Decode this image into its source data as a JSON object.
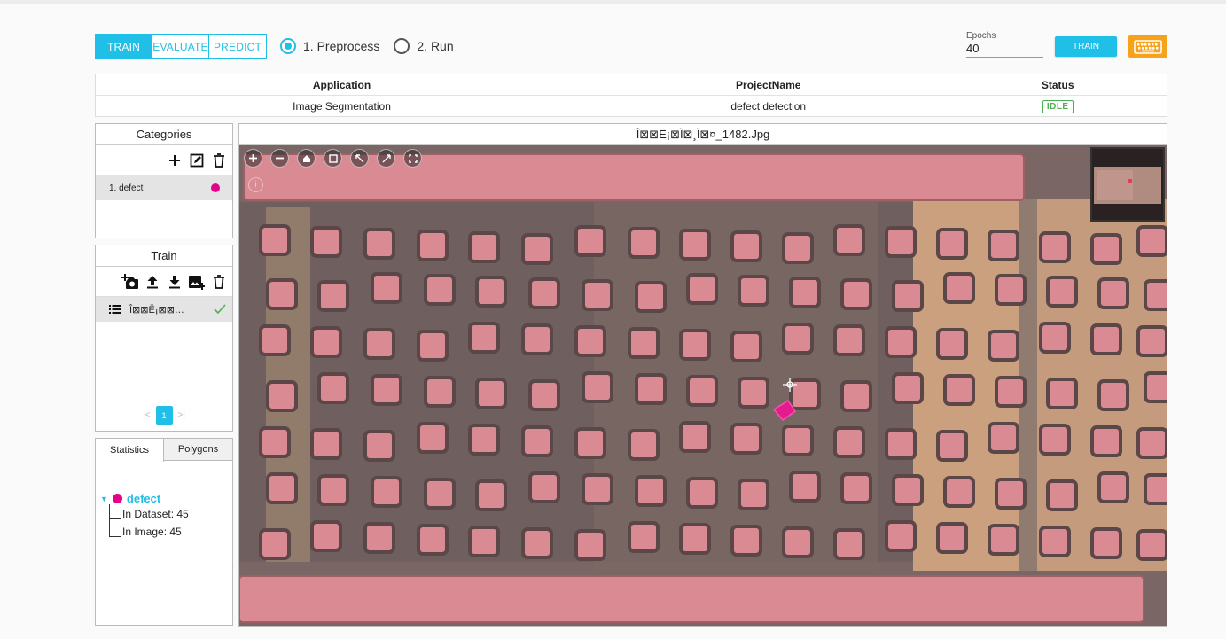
{
  "mode_tabs": [
    {
      "label": "TRAIN",
      "active": true
    },
    {
      "label": "EVALUATE",
      "active": false
    },
    {
      "label": "PREDICT",
      "active": false
    }
  ],
  "steps": [
    {
      "label": "1. Preprocess",
      "checked": true
    },
    {
      "label": "2. Run",
      "checked": false
    }
  ],
  "epochs": {
    "label": "Epochs",
    "value": "40"
  },
  "train_button": "TRAIN",
  "keyboard_icon": "keyboard-icon",
  "project": {
    "headers": [
      "Application",
      "ProjectName",
      "Status"
    ],
    "application": "Image Segmentation",
    "project_name": "defect detection",
    "status": "IDLE"
  },
  "categories": {
    "title": "Categories",
    "items": [
      {
        "label": "1. defect",
        "color": "#e6008a"
      }
    ]
  },
  "train": {
    "title": "Train",
    "items": [
      {
        "label": "Î⊠⊠Ë¡⊠⊠…"
      }
    ],
    "page": "1"
  },
  "stats": {
    "tabs": [
      "Statistics",
      "Polygons"
    ],
    "root_label": "defect",
    "in_dataset": "In Dataset: 45",
    "in_image": "In Image: 45"
  },
  "viewer": {
    "filename": "Î⊠⊠Ë¡⊠Ì⊠¸Ì⊠¤_1482.Jpg"
  },
  "colors": {
    "accent": "#1fbfe8",
    "defect": "#e6008a",
    "status_ok": "#4caf50",
    "keyboard": "#f7a21b"
  }
}
